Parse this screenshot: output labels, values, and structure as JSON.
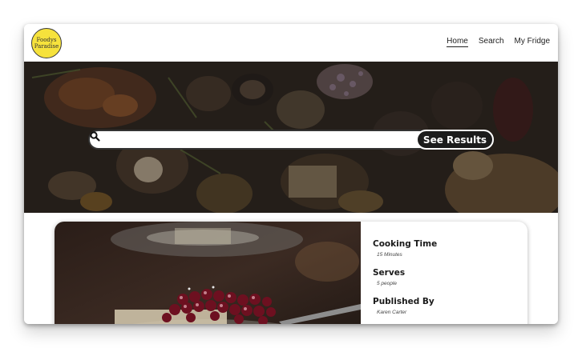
{
  "header": {
    "logo_line1": "Foodys",
    "logo_line2": "Paradise",
    "nav": [
      "Home",
      "Search",
      "My Fridge"
    ],
    "active_nav": "Home"
  },
  "search": {
    "value": "",
    "placeholder": "",
    "button_label": "See Results"
  },
  "recipe": {
    "cooking_time_label": "Cooking Time",
    "cooking_time_value": "15 Minutes",
    "serves_label": "Serves",
    "serves_value": "5 people",
    "published_by_label": "Published By",
    "published_by_value": "Karen Carter"
  },
  "colors": {
    "logo_fill": "#f6e23c",
    "button_bg": "#1c1c1c",
    "hero_overlay": "#2a2420"
  },
  "icons": [
    "search-icon"
  ]
}
